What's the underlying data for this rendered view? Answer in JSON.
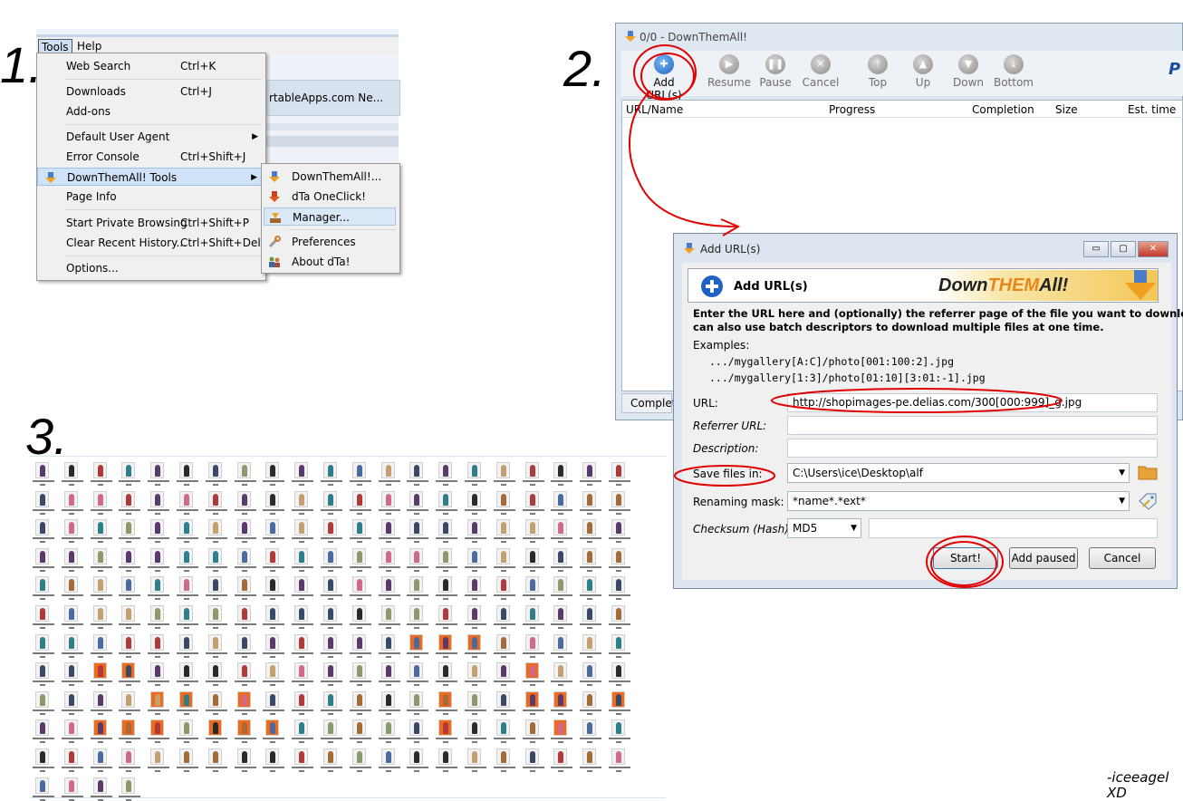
{
  "steps": {
    "one": "1.",
    "two": "2.",
    "three": "3."
  },
  "panel1": {
    "menubar": {
      "tools": "Tools",
      "help": "Help"
    },
    "background_tab": "rtableApps.com Ne...",
    "tools_menu": [
      {
        "label": "Web Search",
        "shortcut": "Ctrl+K"
      },
      {
        "label": "Downloads",
        "shortcut": "Ctrl+J"
      },
      {
        "label": "Add-ons",
        "shortcut": ""
      },
      {
        "label": "Default User Agent",
        "shortcut": ""
      },
      {
        "label": "Error Console",
        "shortcut": "Ctrl+Shift+J"
      },
      {
        "label": "DownThemAll! Tools",
        "shortcut": ""
      },
      {
        "label": "Page Info",
        "shortcut": ""
      },
      {
        "label": "Start Private Browsing",
        "shortcut": "Ctrl+Shift+P"
      },
      {
        "label": "Clear Recent History...",
        "shortcut": "Ctrl+Shift+Del"
      },
      {
        "label": "Options...",
        "shortcut": ""
      }
    ],
    "dta_submenu": [
      {
        "label": "DownThemAll!...",
        "icon": "down-arrow-icon"
      },
      {
        "label": "dTa OneClick!",
        "icon": "oneclick-icon"
      },
      {
        "label": "Manager...",
        "icon": "manager-icon"
      },
      {
        "label": "Preferences",
        "icon": "wrench-icon"
      },
      {
        "label": "About dTa!",
        "icon": "people-icon"
      }
    ]
  },
  "panel2": {
    "window_title": "0/0 - DownThemAll!",
    "toolbar": [
      {
        "label": "Add URL(s)",
        "icon": "plus-icon"
      },
      {
        "label": "Resume",
        "icon": "play-icon"
      },
      {
        "label": "Pause",
        "icon": "pause-icon"
      },
      {
        "label": "Cancel",
        "icon": "cancel-icon"
      },
      {
        "label": "Top",
        "icon": "top-icon"
      },
      {
        "label": "Up",
        "icon": "up-icon"
      },
      {
        "label": "Down",
        "icon": "down-icon"
      },
      {
        "label": "Bottom",
        "icon": "bottom-icon"
      }
    ],
    "logo_fragment": "P",
    "columns": [
      "URL/Name",
      "Progress",
      "Completion",
      "Size",
      "Est. time"
    ],
    "status_text": "Complet",
    "dialog": {
      "title": "Add URL(s)",
      "banner_title": "Add URL(s)",
      "logo_text_a": "Down",
      "logo_text_b": "THEM",
      "logo_text_c": "All!",
      "intro_line1": "Enter the URL here and (optionally) the referrer page of the file you want to download. You",
      "intro_line2": "can also use batch descriptors to download multiple files at one time.",
      "examples_label": "Examples:",
      "example1": ".../mygallery[A:C]/photo[001:100:2].jpg",
      "example2": ".../mygallery[1:3]/photo[01:10][3:01:-1].jpg",
      "url_label": "URL:",
      "url_value": "http://shopimages-pe.delias.com/300[000:999]_g.jpg",
      "referrer_label": "Referrer URL:",
      "description_label": "Description:",
      "save_label": "Save files in:",
      "save_value": "C:\\Users\\ice\\Desktop\\alf",
      "mask_label": "Renaming mask:",
      "mask_value": "*name*.*ext*",
      "checksum_label": "Checksum (Hash):",
      "checksum_value": "MD5",
      "start_button": "Start!",
      "add_paused_button": "Add paused",
      "cancel_button": "Cancel",
      "win_minimize": "▭",
      "win_maximize": "▢",
      "win_close": "✕"
    }
  },
  "panel3": {
    "thumbnail_rows": 12,
    "thumbnail_columns": 21,
    "last_row_count": 4
  },
  "signature": {
    "line1": "-iceeagel",
    "line2": "XD"
  },
  "colors": {
    "annotation": "#e00000",
    "orange_bg": "#f06a1c",
    "highlight": "#cfe2f7",
    "accent_blue": "#1d62c4"
  }
}
